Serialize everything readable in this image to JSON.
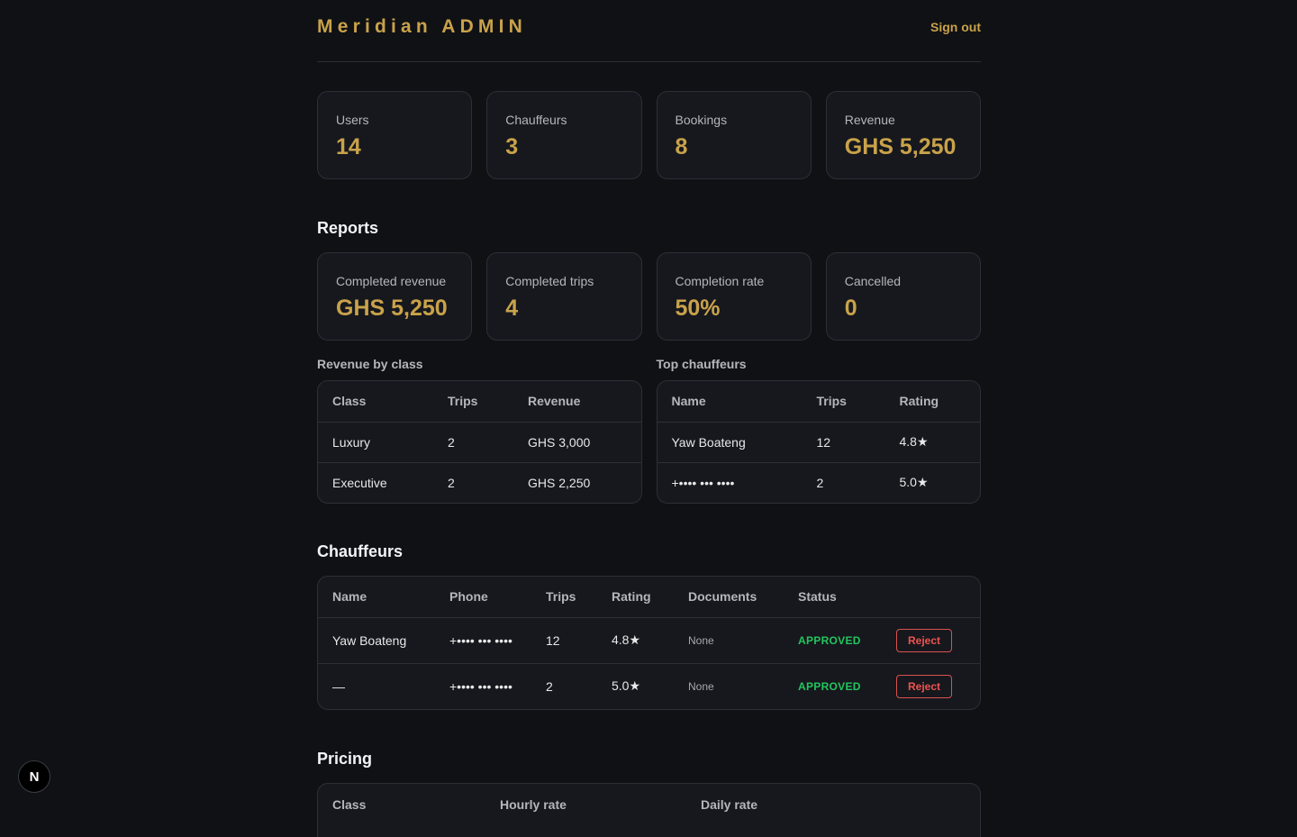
{
  "header": {
    "brand": "Meridian ADMIN",
    "signout_label": "Sign out"
  },
  "stats": [
    {
      "label": "Users",
      "value": "14"
    },
    {
      "label": "Chauffeurs",
      "value": "3"
    },
    {
      "label": "Bookings",
      "value": "8"
    },
    {
      "label": "Revenue",
      "value": "GHS 5,250"
    }
  ],
  "reports": {
    "title": "Reports",
    "cards": [
      {
        "label": "Completed revenue",
        "value": "GHS 5,250"
      },
      {
        "label": "Completed trips",
        "value": "4"
      },
      {
        "label": "Completion rate",
        "value": "50%"
      },
      {
        "label": "Cancelled",
        "value": "0"
      }
    ],
    "revenue_by_class": {
      "title": "Revenue by class",
      "columns": [
        "Class",
        "Trips",
        "Revenue"
      ],
      "rows": [
        [
          "Luxury",
          "2",
          "GHS 3,000"
        ],
        [
          "Executive",
          "2",
          "GHS 2,250"
        ]
      ]
    },
    "top_chauffeurs": {
      "title": "Top chauffeurs",
      "columns": [
        "Name",
        "Trips",
        "Rating"
      ],
      "rows": [
        [
          "Yaw Boateng",
          "12",
          "4.8★"
        ],
        [
          "+•••• ••• ••••",
          "2",
          "5.0★"
        ]
      ]
    }
  },
  "chauffeurs": {
    "title": "Chauffeurs",
    "columns": [
      "Name",
      "Phone",
      "Trips",
      "Rating",
      "Documents",
      "Status",
      ""
    ],
    "rows": [
      {
        "name": "Yaw Boateng",
        "phone": "+•••• ••• ••••",
        "trips": "12",
        "rating": "4.8★",
        "documents": "None",
        "status": "APPROVED",
        "action": "Reject"
      },
      {
        "name": "—",
        "phone": "+•••• ••• ••••",
        "trips": "2",
        "rating": "5.0★",
        "documents": "None",
        "status": "APPROVED",
        "action": "Reject"
      }
    ]
  },
  "pricing": {
    "title": "Pricing",
    "columns": [
      "Class",
      "Hourly rate",
      "Daily rate"
    ]
  },
  "dev_badge": {
    "letter": "N"
  },
  "colors": {
    "accent": "#c9a24a",
    "approved": "#22c55e",
    "danger": "#ef5350",
    "background": "#0f1115"
  }
}
